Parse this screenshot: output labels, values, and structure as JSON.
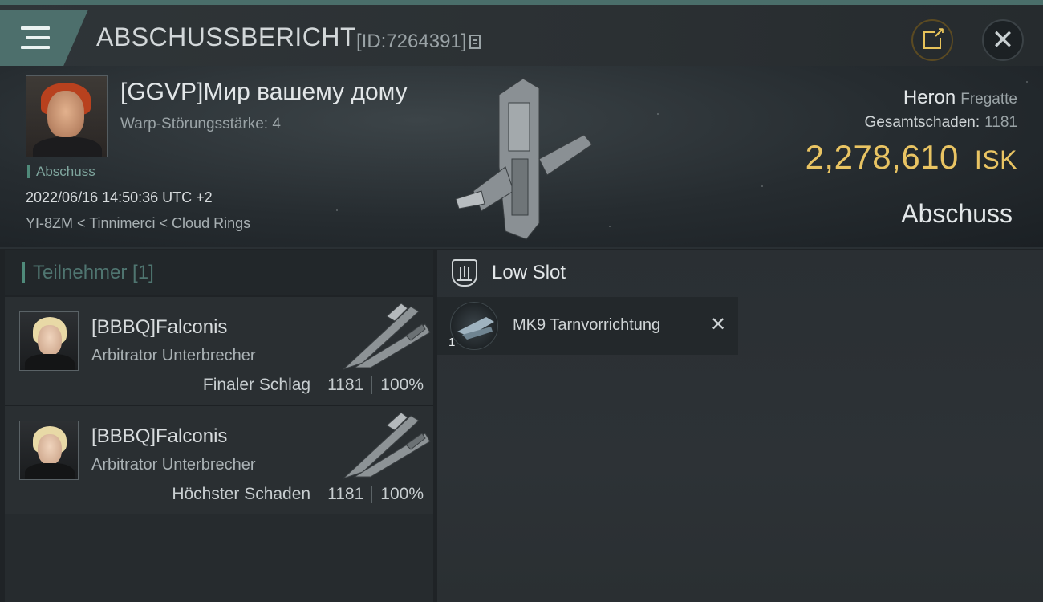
{
  "header": {
    "title": "ABSCHUSSBERICHT",
    "report_id": "[ID:7264391]",
    "icons": {
      "menu": "menu-icon",
      "copy": "copy-icon",
      "share": "share-icon",
      "close": "close-icon"
    },
    "close_glyph": "✕"
  },
  "victim": {
    "name": "[GGVP]Мир вашему дому",
    "warp_strength": "Warp-Störungsstärke: 4",
    "tag": "Abschuss",
    "timestamp": "2022/06/16 14:50:36 UTC +2",
    "location": "YI-8ZM < Tinnimerci < Cloud Rings",
    "ship_name": "Heron",
    "ship_class": "Fregatte",
    "damage_label": "Gesamtschaden:",
    "damage_value": "1181",
    "isk_value": "2,278,610",
    "isk_unit": "ISK",
    "result": "Abschuss"
  },
  "participants": {
    "header": "Teilnehmer [1]",
    "items": [
      {
        "name": "[BBBQ]Falconis",
        "ship": "Arbitrator Unterbrecher",
        "role": "Finaler Schlag",
        "damage": "1181",
        "percent": "100%"
      },
      {
        "name": "[BBBQ]Falconis",
        "ship": "Arbitrator Unterbrecher",
        "role": "Höchster Schaden",
        "damage": "1181",
        "percent": "100%"
      }
    ]
  },
  "slots": {
    "title": "Low Slot",
    "items": [
      {
        "name": "MK9 Tarnvorrichtung",
        "qty": "1",
        "status_glyph": "✕"
      }
    ]
  },
  "colors": {
    "accent": "#4d6f6c",
    "isk": "#e9c463",
    "kill_tag": "#4f8a7a",
    "share_ring": "#e6c25a"
  }
}
